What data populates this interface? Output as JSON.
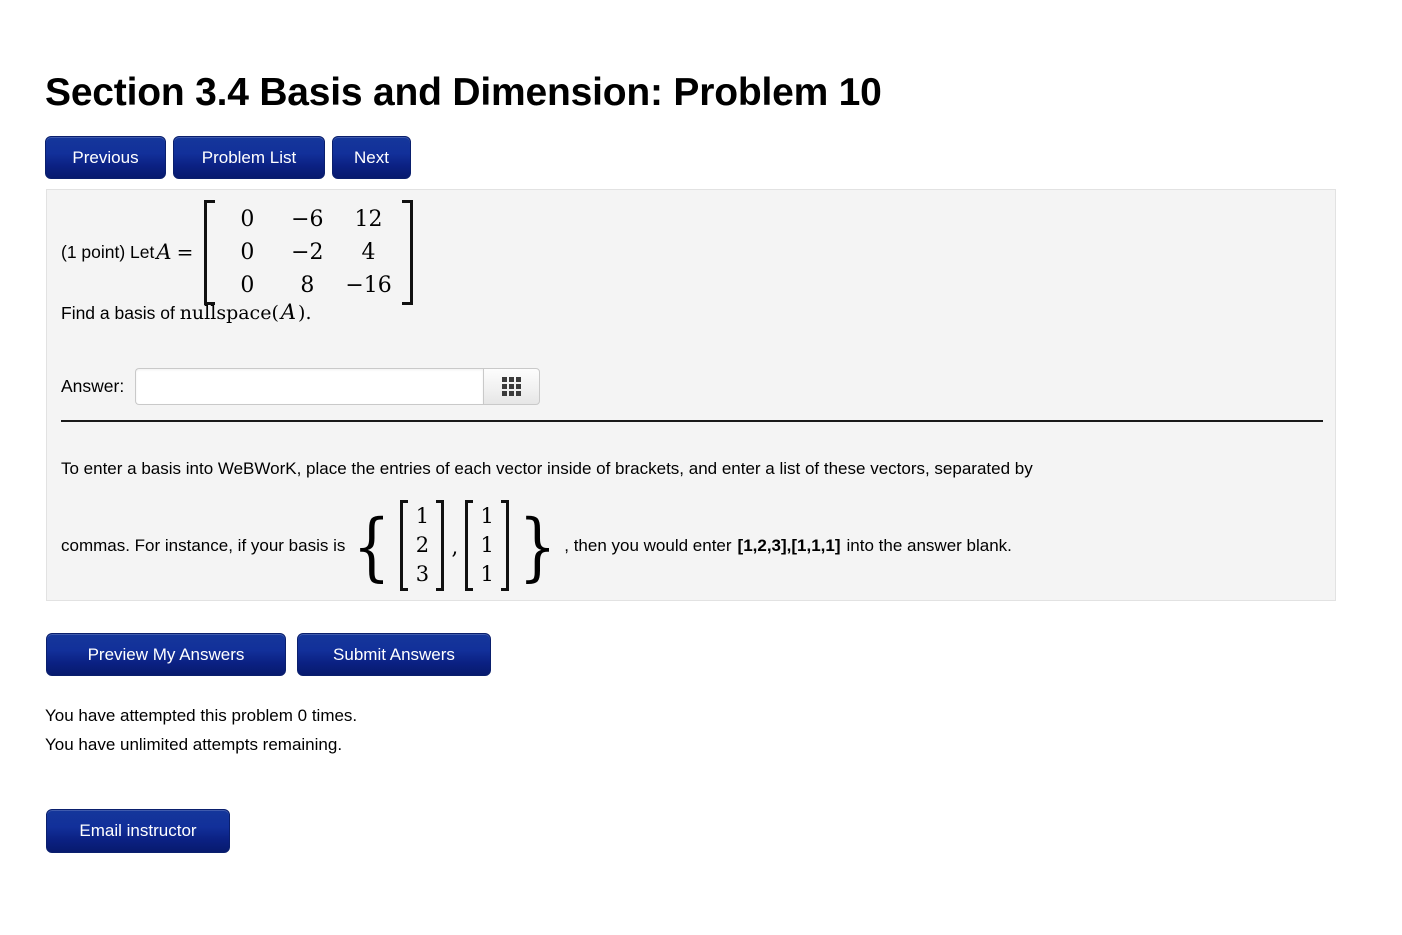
{
  "page_title": "Section 3.4 Basis and Dimension: Problem 10",
  "nav": {
    "previous": "Previous",
    "problem_list": "Problem List",
    "next": "Next"
  },
  "problem": {
    "points_text": "(1 point) Let",
    "variable": "A",
    "equals": "=",
    "matrix": {
      "rows": [
        [
          "0",
          "−6",
          "12"
        ],
        [
          "0",
          "−2",
          "4"
        ],
        [
          "0",
          "8",
          "−16"
        ]
      ]
    },
    "find_prefix": "Find a basis of",
    "find_function": "nullspace",
    "find_open": "(",
    "find_arg": "A",
    "find_close": ").",
    "answer_label": "Answer:",
    "answer_value": "",
    "answer_placeholder": "",
    "keypad_icon": "grid-keypad-icon"
  },
  "hint": {
    "line1": "To enter a basis into WeBWorK, place the entries of each vector inside of brackets, and enter a list of these vectors, separated by",
    "line2_before": "commas. For instance, if your basis is",
    "brace_open": "{",
    "vector1": [
      "1",
      "2",
      "3"
    ],
    "vector_separator": ",",
    "vector2": [
      "1",
      "1",
      "1"
    ],
    "brace_close": "}",
    "line2_mid": ", then you would enter",
    "entry_example": "[1,2,3],[1,1,1]",
    "line2_after": "into the answer blank."
  },
  "actions": {
    "preview": "Preview My Answers",
    "submit": "Submit Answers"
  },
  "status": {
    "attempts": "You have attempted this problem 0 times.",
    "remaining": "You have unlimited attempts remaining."
  },
  "footer": {
    "email_instructor": "Email instructor"
  },
  "colors": {
    "button_blue_top": "#15379b",
    "button_blue_bottom": "#071a6e",
    "panel_background": "#f4f4f4",
    "panel_border": "#e2e2e2",
    "divider": "#1a1a1a",
    "text": "#000000"
  }
}
